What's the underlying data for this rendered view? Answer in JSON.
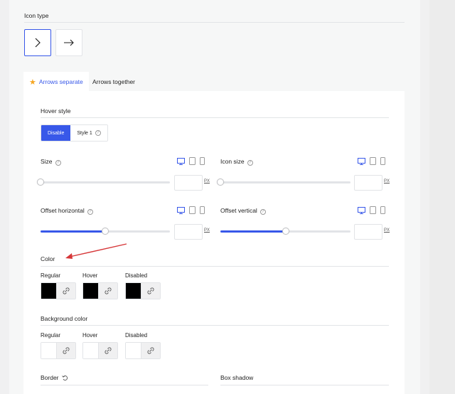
{
  "icon_type": {
    "label": "Icon type",
    "options": [
      {
        "name": "chevron-right",
        "selected": true
      },
      {
        "name": "arrow-right",
        "selected": false
      }
    ]
  },
  "tabs": [
    {
      "label": "Arrows separate",
      "active": true,
      "icon": "star-icon"
    },
    {
      "label": "Arrows together",
      "active": false
    }
  ],
  "hover_style": {
    "label": "Hover style",
    "options": [
      {
        "label": "Disable",
        "selected": true
      },
      {
        "label": "Style 1",
        "selected": false
      }
    ]
  },
  "size": {
    "label": "Size",
    "unit": "PX",
    "value_fraction": 0.0
  },
  "icon_size": {
    "label": "Icon size",
    "unit": "PX",
    "value_fraction": 0.0
  },
  "offset_horizontal": {
    "label": "Offset horizontal",
    "unit": "PX",
    "value_fraction": 0.5
  },
  "offset_vertical": {
    "label": "Offset vertical",
    "unit": "PX",
    "value_fraction": 0.5
  },
  "color": {
    "label": "Color",
    "states": [
      {
        "label": "Regular",
        "swatch": "#000000"
      },
      {
        "label": "Hover",
        "swatch": "#000000"
      },
      {
        "label": "Disabled",
        "swatch": "#000000"
      }
    ]
  },
  "background_color": {
    "label": "Background color",
    "states": [
      {
        "label": "Regular",
        "swatch": "#ffffff"
      },
      {
        "label": "Hover",
        "swatch": "#ffffff"
      },
      {
        "label": "Disabled",
        "swatch": "#ffffff"
      }
    ]
  },
  "border": {
    "label": "Border"
  },
  "box_shadow": {
    "label": "Box shadow"
  },
  "colors": {
    "accent": "#3858e9",
    "annotation": "#d63638",
    "star": "#f5a623"
  }
}
